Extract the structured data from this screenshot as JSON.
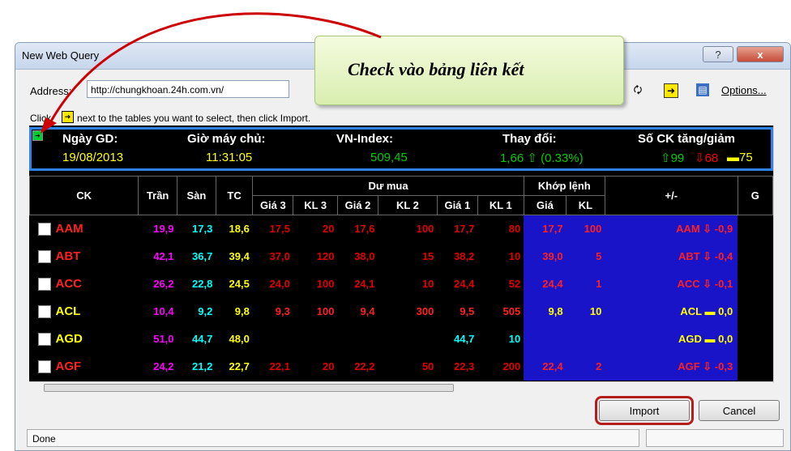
{
  "window": {
    "title": "New Web Query",
    "help_label": "?",
    "close_label": "x"
  },
  "address": {
    "label": "Address:",
    "value": "http://chungkhoan.24h.com.vn/",
    "options_label": "Options..."
  },
  "instruction": {
    "click": "Click",
    "text": "next to the tables you want to select, then click Import."
  },
  "info": {
    "ngay_label": "Ngày GD:",
    "ngay_value": "19/08/2013",
    "gio_label": "Giờ máy chủ:",
    "gio_value": "11:31:05",
    "vn_label": "VN-Index:",
    "vn_value": "509,45",
    "thaydoi_label": "Thay đổi:",
    "thaydoi_value": "1,66 ⇧ (0.33%)",
    "soCK_label": "Số CK tăng/giảm",
    "tang": "99",
    "giam": "68",
    "dung": "75"
  },
  "table": {
    "headers": {
      "ck": "CK",
      "tran": "Trần",
      "san": "Sàn",
      "tc": "TC",
      "dumua": "Dư mua",
      "khoplenh": "Khớp lệnh",
      "pm": "+/-",
      "g3": "Giá 3",
      "kl3": "KL 3",
      "g2": "Giá 2",
      "kl2": "KL 2",
      "g1": "Giá 1",
      "kl1": "KL 1",
      "gia": "Giá",
      "kl": "KL",
      "extra": "G"
    },
    "rows": [
      [
        "AAM",
        "19,9",
        "17,3",
        "18,6",
        "17,5",
        "20",
        "17,6",
        "100",
        "17,7",
        "80",
        "17,7",
        "100",
        "AAM ⇩ -0,9"
      ],
      [
        "ABT",
        "42,1",
        "36,7",
        "39,4",
        "37,0",
        "120",
        "38,0",
        "15",
        "38,2",
        "10",
        "39,0",
        "5",
        "ABT ⇩ -0,4"
      ],
      [
        "ACC",
        "26,2",
        "22,8",
        "24,5",
        "24,0",
        "100",
        "24,1",
        "10",
        "24,4",
        "52",
        "24,4",
        "1",
        "ACC ⇩ -0,1"
      ],
      [
        "ACL",
        "10,4",
        "9,2",
        "9,8",
        "9,3",
        "100",
        "9,4",
        "300",
        "9,5",
        "505",
        "9,8",
        "10",
        "ACL ▬ 0,0"
      ],
      [
        "AGD",
        "51,0",
        "44,7",
        "48,0",
        "",
        "",
        "",
        "",
        "44,7",
        "10",
        "",
        "",
        "AGD ▬ 0,0"
      ],
      [
        "AGF",
        "24,2",
        "21,2",
        "22,7",
        "22,1",
        "20",
        "22,2",
        "50",
        "22,3",
        "200",
        "22,4",
        "2",
        "AGF ⇩ -0,3"
      ]
    ]
  },
  "buttons": {
    "import": "Import",
    "cancel": "Cancel"
  },
  "status": "Done",
  "callout": "Check vào bảng liên kết",
  "colors": {
    "tran": "#ff00ff",
    "san": "#00ffff",
    "tc": "#ffff00",
    "down": "#ff0000",
    "equal": "#ffff00",
    "info_up": "#00cc00",
    "frame": "#2f83e8",
    "callout_border": "#b51d1d"
  }
}
